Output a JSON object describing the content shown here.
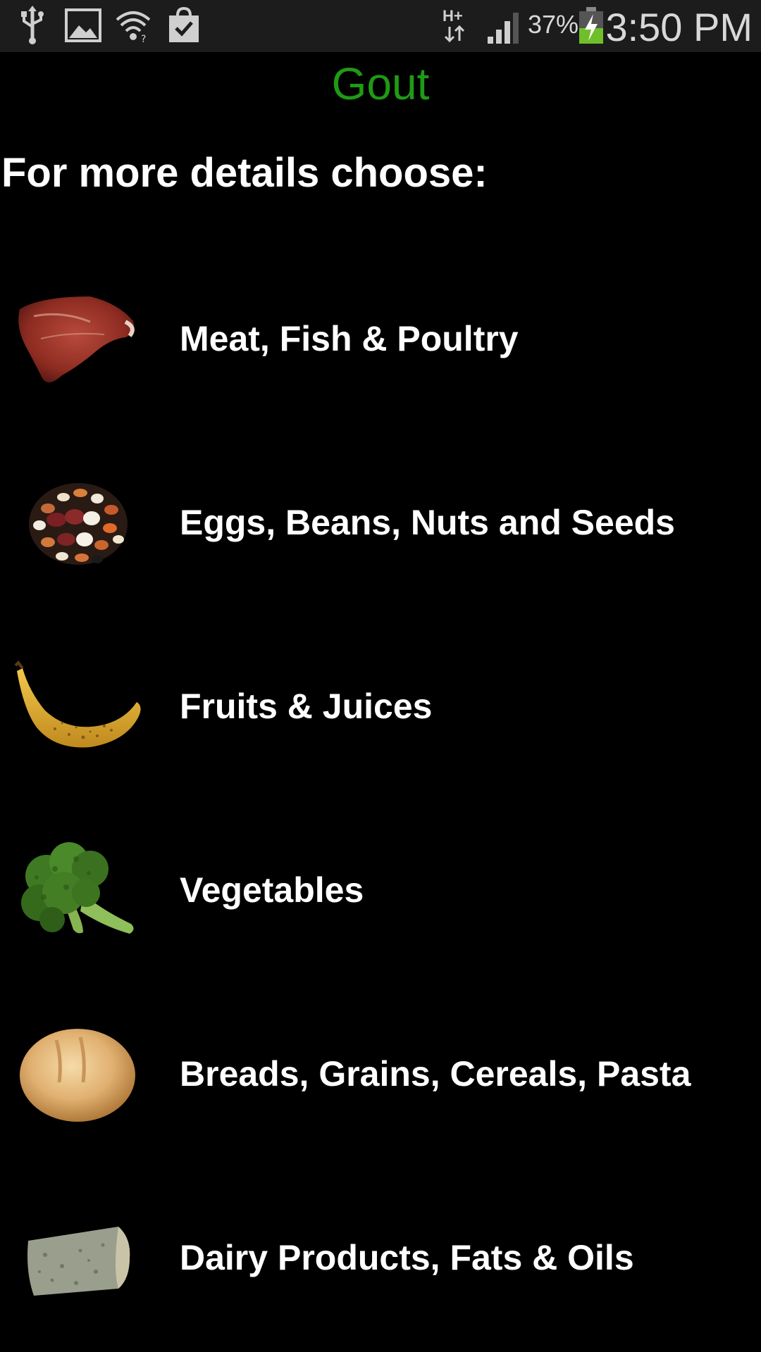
{
  "status_bar": {
    "icons": [
      "usb-icon",
      "gallery-icon",
      "wifi-icon",
      "shopping-bag-icon",
      "hplus-data-icon",
      "signal-icon",
      "battery-charging-icon"
    ],
    "network_type": "H+",
    "battery_percent": "37%",
    "time": "3:50 PM"
  },
  "header": {
    "title": "Gout",
    "title_color": "#1f9a14"
  },
  "subtitle": "For more details choose:",
  "categories": [
    {
      "label": "Meat, Fish & Poultry",
      "icon": "steak-icon"
    },
    {
      "label": "Eggs, Beans, Nuts and Seeds",
      "icon": "beans-icon"
    },
    {
      "label": "Fruits & Juices",
      "icon": "banana-icon"
    },
    {
      "label": "Vegetables",
      "icon": "broccoli-icon"
    },
    {
      "label": "Breads, Grains, Cereals, Pasta",
      "icon": "bread-icon"
    },
    {
      "label": "Dairy Products, Fats & Oils",
      "icon": "cheese-icon"
    }
  ]
}
